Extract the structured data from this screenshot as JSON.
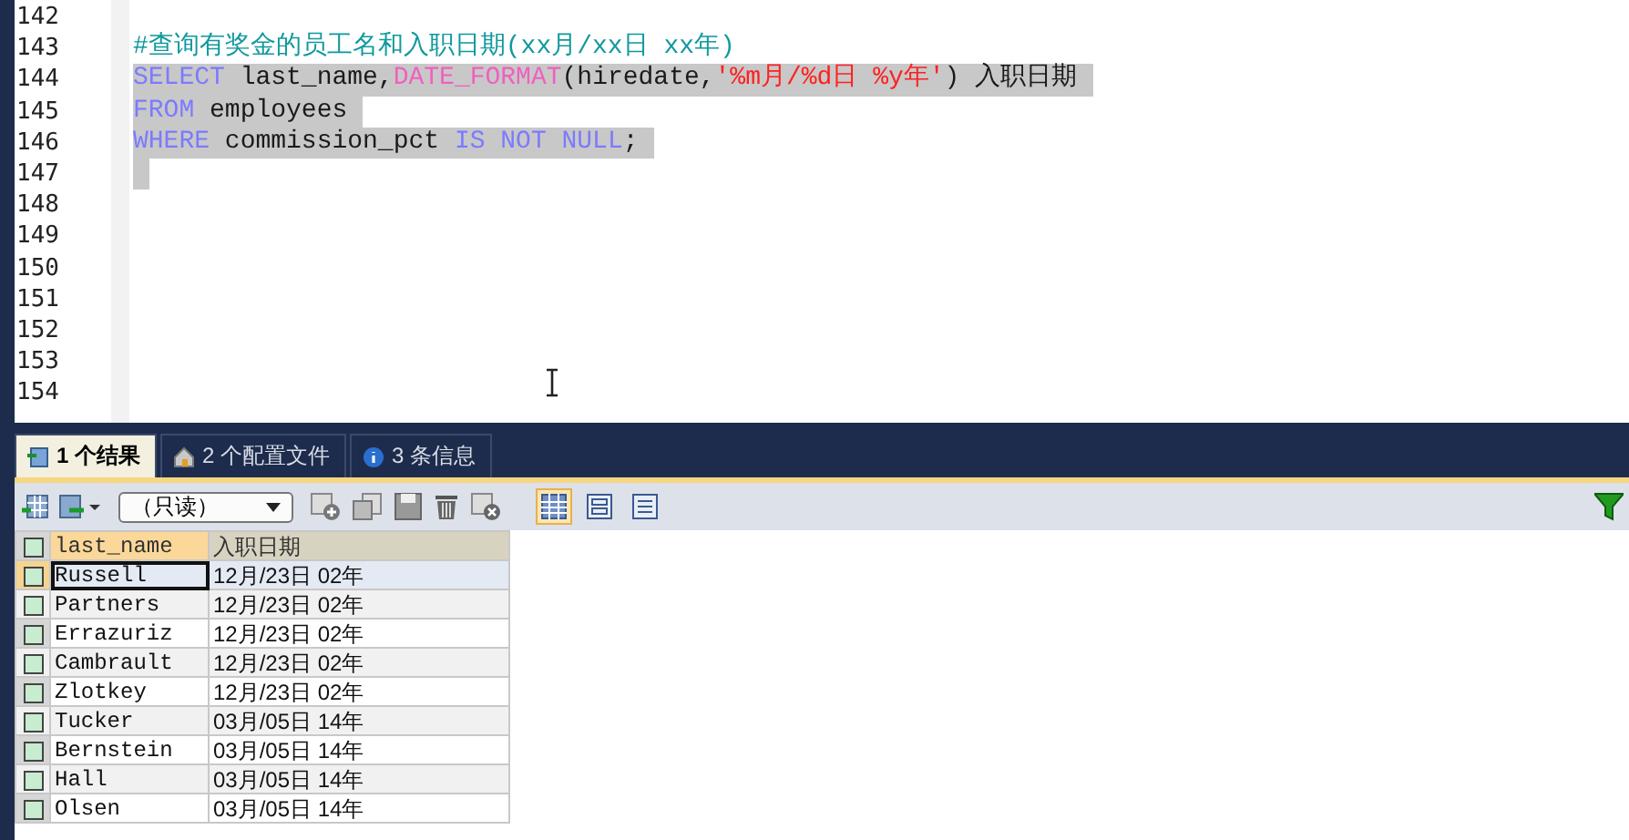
{
  "editor": {
    "lines": [
      {
        "number": "142",
        "selected": false
      },
      {
        "number": "143",
        "selected": false,
        "tokens": [
          {
            "kind": "comment",
            "text": "#查询有奖金的员工名和入职日期(xx月/xx日 xx年)"
          }
        ]
      },
      {
        "number": "144",
        "selected": true,
        "tokens": [
          {
            "kind": "keyword",
            "text": "SELECT"
          },
          {
            "kind": "plain",
            "text": " last_name,"
          },
          {
            "kind": "function",
            "text": "DATE_FORMAT"
          },
          {
            "kind": "plain",
            "text": "(hiredate,"
          },
          {
            "kind": "string",
            "text": "'%m月/%d日 %y年'"
          },
          {
            "kind": "plain",
            "text": ") 入职日期 "
          }
        ]
      },
      {
        "number": "145",
        "selected": true,
        "tokens": [
          {
            "kind": "keyword",
            "text": "FROM"
          },
          {
            "kind": "plain",
            "text": " employees "
          }
        ]
      },
      {
        "number": "146",
        "selected": true,
        "tokens": [
          {
            "kind": "keyword",
            "text": "WHERE"
          },
          {
            "kind": "plain",
            "text": " commission_pct "
          },
          {
            "kind": "keyword",
            "text": "IS NOT NULL"
          },
          {
            "kind": "plain",
            "text": "; "
          }
        ]
      },
      {
        "number": "147",
        "selected": true
      },
      {
        "number": "148",
        "selected": false
      },
      {
        "number": "149",
        "selected": false
      },
      {
        "number": "150",
        "selected": false
      },
      {
        "number": "151",
        "selected": false
      },
      {
        "number": "152",
        "selected": false
      },
      {
        "number": "153",
        "selected": false
      },
      {
        "number": "154",
        "selected": false
      }
    ]
  },
  "result_tabs": [
    {
      "label": "1 个结果",
      "kind": "result",
      "selected": true
    },
    {
      "label": "2 个配置文件",
      "kind": "profile",
      "selected": false
    },
    {
      "label": "3 条信息",
      "kind": "info",
      "selected": false
    }
  ],
  "toolbar": {
    "mode": "（只读）",
    "views": [
      {
        "kind": "grid",
        "selected": true
      },
      {
        "kind": "form",
        "selected": false
      },
      {
        "kind": "text",
        "selected": false
      }
    ]
  },
  "table": {
    "select_all_checked": false,
    "columns": [
      "last_name",
      "入职日期"
    ],
    "rows": [
      {
        "cells": [
          "Russell",
          "12月/23日 02年"
        ],
        "selected": true
      },
      {
        "cells": [
          "Partners",
          "12月/23日 02年"
        ],
        "selected": false
      },
      {
        "cells": [
          "Errazuriz",
          "12月/23日 02年"
        ],
        "selected": false
      },
      {
        "cells": [
          "Cambrault",
          "12月/23日 02年"
        ],
        "selected": false
      },
      {
        "cells": [
          "Zlotkey",
          "12月/23日 02年"
        ],
        "selected": false
      },
      {
        "cells": [
          "Tucker",
          "03月/05日 14年"
        ],
        "selected": false
      },
      {
        "cells": [
          "Bernstein",
          "03月/05日 14年"
        ],
        "selected": false
      },
      {
        "cells": [
          "Hall",
          "03月/05日 14年"
        ],
        "selected": false
      },
      {
        "cells": [
          "Olsen",
          "03月/05日 14年"
        ],
        "selected": false
      }
    ]
  }
}
